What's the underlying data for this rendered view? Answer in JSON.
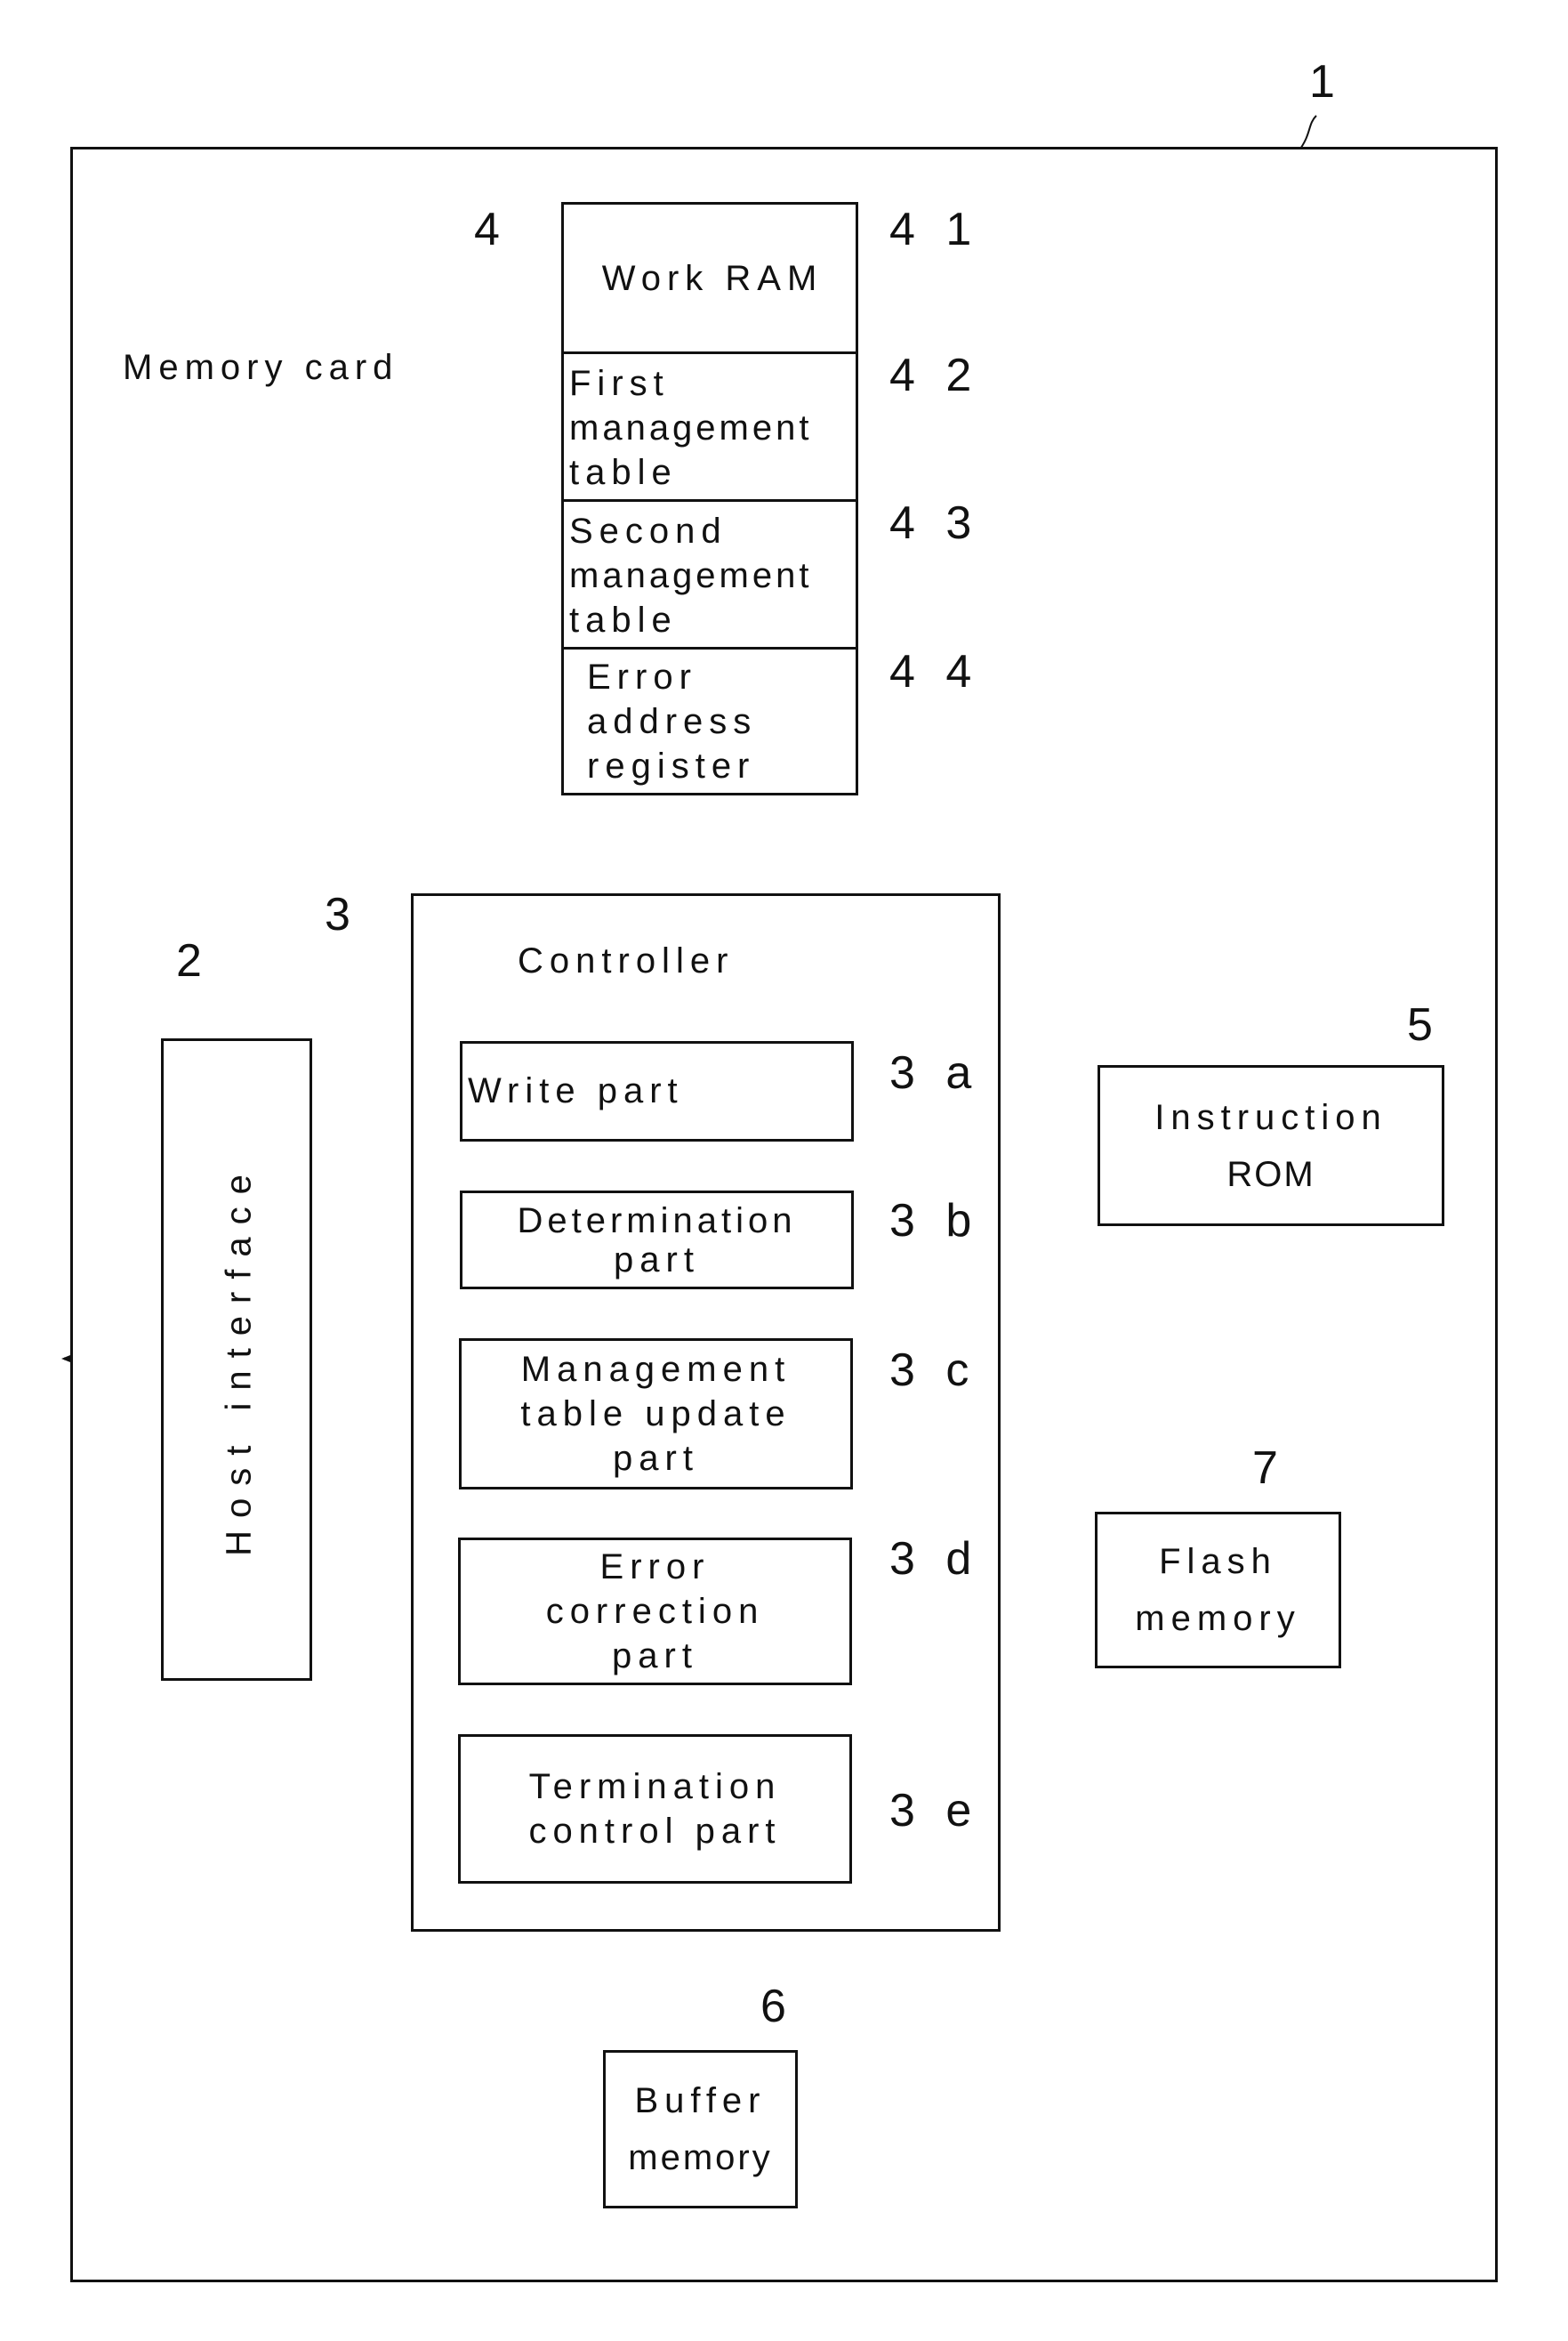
{
  "figure": {
    "outer": {
      "ref": "1",
      "label": "Memory card"
    },
    "work_ram": {
      "ref": "4",
      "cells": [
        {
          "ref": "4 1",
          "lines": [
            "Work RAM"
          ]
        },
        {
          "ref": "4 2",
          "lines": [
            "First",
            "management",
            "table"
          ]
        },
        {
          "ref": "4 3",
          "lines": [
            "Second",
            "management",
            "table"
          ]
        },
        {
          "ref": "4 4",
          "lines": [
            "Error",
            "address",
            "register"
          ]
        }
      ]
    },
    "controller": {
      "ref": "3",
      "title": "Controller",
      "parts": [
        {
          "ref": "3 a",
          "lines": [
            "Write part"
          ]
        },
        {
          "ref": "3 b",
          "lines": [
            "Determination",
            "part"
          ]
        },
        {
          "ref": "3 c",
          "lines": [
            "Management",
            "table update",
            "part"
          ]
        },
        {
          "ref": "3 d",
          "lines": [
            "Error",
            "correction",
            "part"
          ]
        },
        {
          "ref": "3 e",
          "lines": [
            "Termination",
            "control part"
          ]
        }
      ]
    },
    "host_interface": {
      "ref": "2",
      "label": "Host interface"
    },
    "instruction_rom": {
      "ref": "5",
      "lines": [
        "Instruction",
        "ROM"
      ]
    },
    "buffer_memory": {
      "ref": "6",
      "lines": [
        "Buffer",
        "memory"
      ]
    },
    "flash_memory": {
      "ref": "7",
      "lines": [
        "Flash",
        "memory"
      ]
    }
  }
}
